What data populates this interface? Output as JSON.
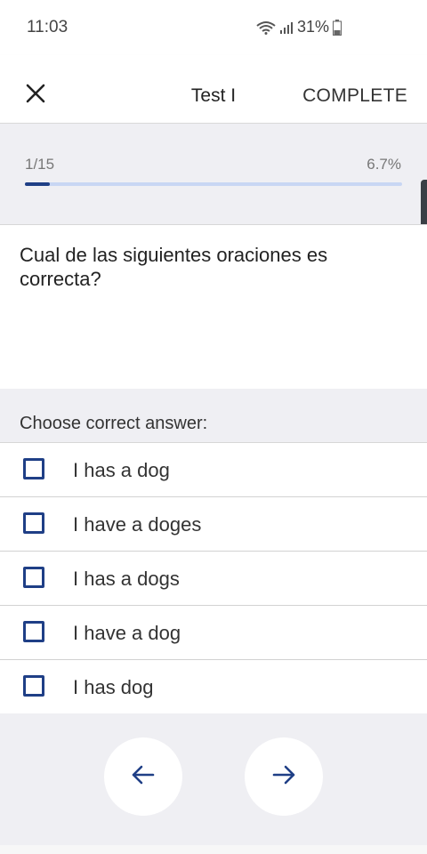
{
  "status_bar": {
    "time": "11:03",
    "battery": "31%",
    "icons": [
      "wifi-icon",
      "signal-icon",
      "battery-icon"
    ]
  },
  "app_bar": {
    "close_icon": "close-icon",
    "title": "Test I",
    "complete_label": "COMPLETE"
  },
  "progress": {
    "count": "1/15",
    "percent_label": "6.7%",
    "fraction": 0.067,
    "fill_color": "#1f3f86",
    "track_color": "#c8d6f3"
  },
  "question": {
    "text": "Cual de las siguientes oraciones es correcta?"
  },
  "instruction": "Choose correct answer:",
  "answers": [
    {
      "label": "I has a dog",
      "checked": false
    },
    {
      "label": "I have a doges",
      "checked": false
    },
    {
      "label": "I has a dogs",
      "checked": false
    },
    {
      "label": "I have a dog",
      "checked": false
    },
    {
      "label": "I has dog",
      "checked": false
    }
  ],
  "navigation": {
    "prev_icon": "arrow-left-icon",
    "next_icon": "arrow-right-icon",
    "accent": "#1f3f86"
  }
}
